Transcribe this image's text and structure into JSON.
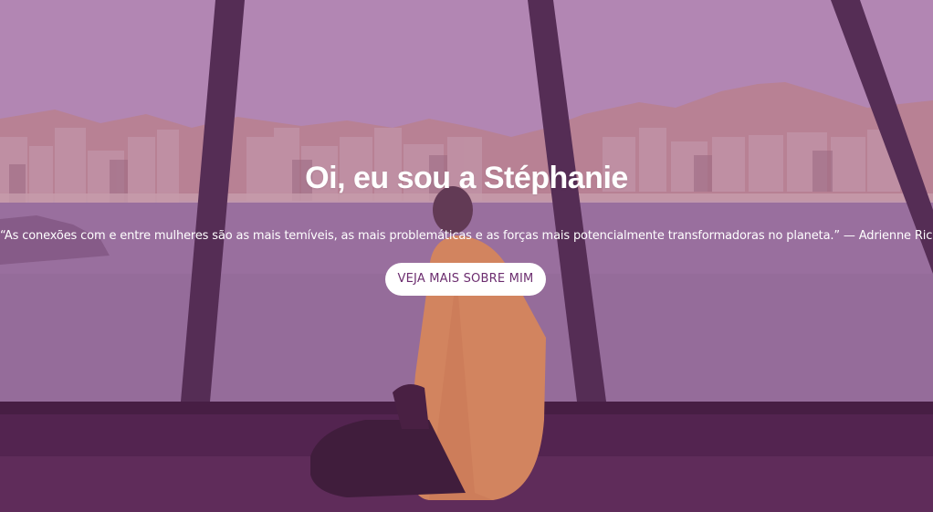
{
  "hero": {
    "title": "Oi, eu sou a Stéphanie",
    "quote": "“As conexões com e entre mulheres são as mais temíveis, as mais problemáticas e as forças mais potencialmente transformadoras no planeta.” — Adrienne Rich",
    "cta_label": "VEJA MAIS SOBRE MIM",
    "overlay_color": "#b690b7",
    "button_text_color": "#6c2d6f"
  }
}
